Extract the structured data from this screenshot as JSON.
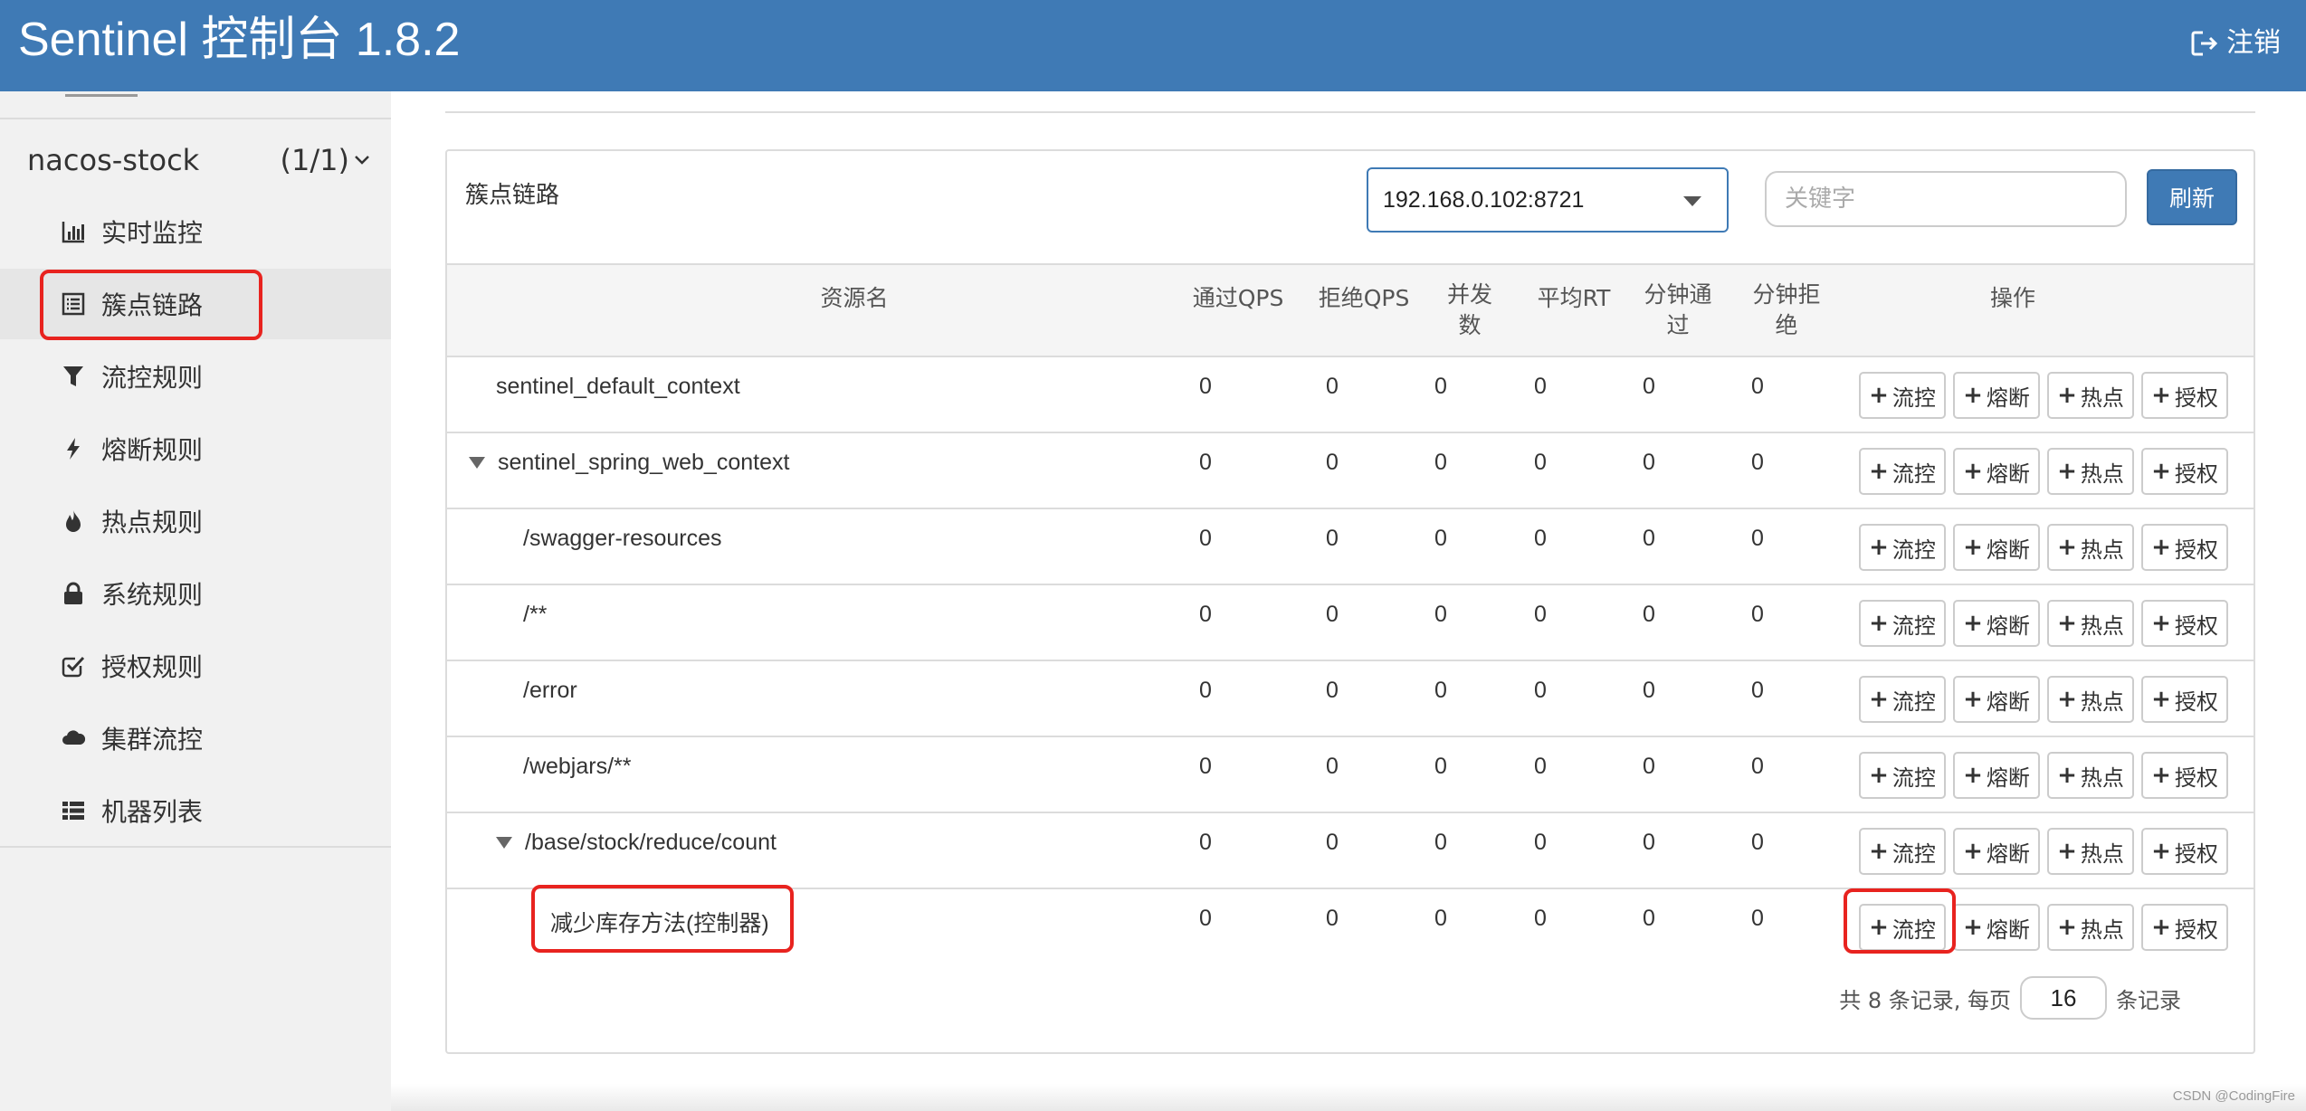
{
  "header": {
    "title": "Sentinel 控制台 1.8.2",
    "logout_label": "注销"
  },
  "sidebar": {
    "app_name": "nacos-stock",
    "app_count": "(1/1)",
    "items": [
      {
        "label": "实时监控",
        "icon": "bar-chart-icon"
      },
      {
        "label": "簇点链路",
        "icon": "list-icon",
        "active": true
      },
      {
        "label": "流控规则",
        "icon": "filter-icon"
      },
      {
        "label": "熔断规则",
        "icon": "bolt-icon"
      },
      {
        "label": "热点规则",
        "icon": "fire-icon"
      },
      {
        "label": "系统规则",
        "icon": "lock-icon"
      },
      {
        "label": "授权规则",
        "icon": "check-square-icon"
      },
      {
        "label": "集群流控",
        "icon": "cloud-icon"
      },
      {
        "label": "机器列表",
        "icon": "th-list-icon"
      }
    ]
  },
  "panel": {
    "title": "簇点链路",
    "machine_select": "192.168.0.102:8721",
    "keyword_placeholder": "关键字",
    "refresh_label": "刷新"
  },
  "table": {
    "headers": {
      "resource": "资源名",
      "pass_qps": "通过QPS",
      "block_qps": "拒绝QPS",
      "concurrency": "并发\n数",
      "avg_rt": "平均RT",
      "minute_pass": "分钟通\n过",
      "minute_block": "分钟拒\n绝",
      "ops": "操作"
    },
    "op_buttons": [
      "流控",
      "熔断",
      "热点",
      "授权"
    ],
    "rows": [
      {
        "name": "sentinel_default_context",
        "values": [
          "0",
          "0",
          "0",
          "0",
          "0",
          "0"
        ]
      },
      {
        "name": "sentinel_spring_web_context",
        "values": [
          "0",
          "0",
          "0",
          "0",
          "0",
          "0"
        ]
      },
      {
        "name": "/swagger-resources",
        "values": [
          "0",
          "0",
          "0",
          "0",
          "0",
          "0"
        ]
      },
      {
        "name": "/**",
        "values": [
          "0",
          "0",
          "0",
          "0",
          "0",
          "0"
        ]
      },
      {
        "name": "/error",
        "values": [
          "0",
          "0",
          "0",
          "0",
          "0",
          "0"
        ]
      },
      {
        "name": "/webjars/**",
        "values": [
          "0",
          "0",
          "0",
          "0",
          "0",
          "0"
        ]
      },
      {
        "name": "/base/stock/reduce/count",
        "values": [
          "0",
          "0",
          "0",
          "0",
          "0",
          "0"
        ]
      },
      {
        "name": "减少库存方法(控制器)",
        "values": [
          "0",
          "0",
          "0",
          "0",
          "0",
          "0"
        ]
      }
    ]
  },
  "pager": {
    "prefix": "共 8 条记录, 每页",
    "page_size": "16",
    "suffix": "条记录"
  },
  "watermark": "CSDN @CodingFire",
  "colors": {
    "header_bg": "#3f7ab5",
    "highlight_red": "#e8231f"
  }
}
